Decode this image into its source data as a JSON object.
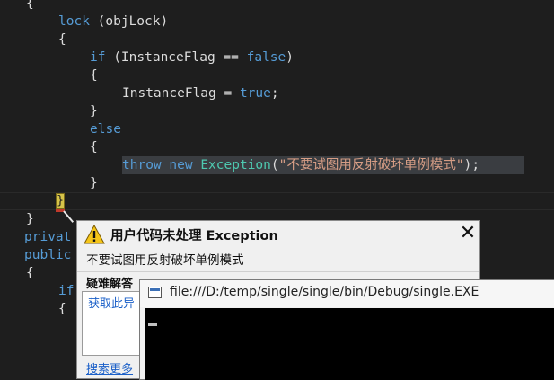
{
  "code": {
    "line1": "{",
    "line2_kw": "lock",
    "line2_rest": " (objLock)",
    "line3": "{",
    "line4_kw": "if",
    "line4_mid": " (InstanceFlag == ",
    "line4_val": "false",
    "line4_end": ")",
    "line5": "{",
    "line6_pre": "InstanceFlag = ",
    "line6_val": "true",
    "line6_end": ";",
    "line7": "}",
    "line8_kw": "else",
    "line9": "{",
    "line10_throw": "throw",
    "line10_new": "new",
    "line10_type": "Exception",
    "line10_open": "(",
    "line10_str": "\"不要试图用反射破坏单例模式\"",
    "line10_end": ");",
    "line11": "}",
    "line12": "}",
    "line13": "}",
    "line14": "privat",
    "line15": "public",
    "line16": "{",
    "line17_kw": "if",
    "line18": "{"
  },
  "exception_popup": {
    "title": "用户代码未处理 Exception",
    "close": "✕",
    "message": "不要试图用反射破坏单例模式",
    "help_heading": "疑难解答",
    "help_link": "获取此异",
    "search_link": "搜索更多"
  },
  "console_window": {
    "title": "file:///D:/temp/single/single/bin/Debug/single.EXE"
  },
  "icons": {
    "warning": "warning-icon",
    "close": "close-icon",
    "console": "console-window-icon"
  },
  "colors": {
    "editor_background": "#1e1e1e",
    "keyword": "#569cd6",
    "type": "#4ec9b0",
    "string": "#d69d85",
    "link": "#1a5fc8",
    "warning": "#f5c518"
  }
}
